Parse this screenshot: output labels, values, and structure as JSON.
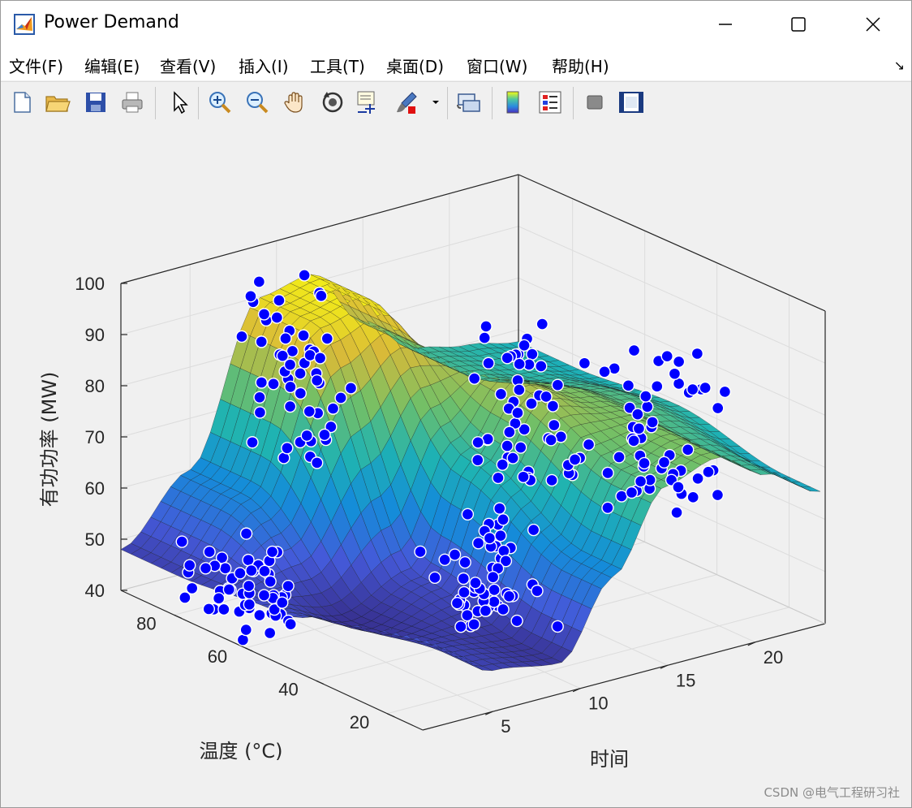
{
  "window": {
    "title": "Power Demand",
    "controls": [
      "minimize",
      "maximize",
      "close"
    ]
  },
  "menu": [
    {
      "label": "文件(F)"
    },
    {
      "label": "编辑(E)"
    },
    {
      "label": "查看(V)"
    },
    {
      "label": "插入(I)"
    },
    {
      "label": "工具(T)"
    },
    {
      "label": "桌面(D)"
    },
    {
      "label": "窗口(W)"
    },
    {
      "label": "帮助(H)"
    }
  ],
  "toolbar": {
    "buttons": [
      {
        "name": "new-figure",
        "icon": "new-file-icon"
      },
      {
        "name": "open-file",
        "icon": "open-folder-icon"
      },
      {
        "name": "save-figure",
        "icon": "save-icon"
      },
      {
        "name": "print-figure",
        "icon": "print-icon"
      },
      {
        "name": "edit-plot",
        "icon": "pointer-icon"
      },
      {
        "name": "zoom-in",
        "icon": "zoom-in-icon"
      },
      {
        "name": "zoom-out",
        "icon": "zoom-out-icon"
      },
      {
        "name": "pan",
        "icon": "hand-icon"
      },
      {
        "name": "rotate-3d",
        "icon": "rotate-icon"
      },
      {
        "name": "data-cursor",
        "icon": "data-cursor-icon"
      },
      {
        "name": "brush",
        "icon": "brush-icon"
      },
      {
        "name": "link-plot",
        "icon": "link-icon"
      },
      {
        "name": "insert-colorbar",
        "icon": "colorbar-icon"
      },
      {
        "name": "insert-legend",
        "icon": "legend-icon"
      },
      {
        "name": "hide-plot-tools",
        "icon": "hide-tools-icon"
      },
      {
        "name": "show-plot-tools",
        "icon": "show-tools-icon"
      }
    ]
  },
  "chart_data": {
    "type": "surface-scatter-3d",
    "title": "",
    "xlabel": "时间",
    "ylabel": "温度 (°C)",
    "zlabel": "有功功率 (MW)",
    "xticks": [
      5,
      10,
      15,
      20
    ],
    "yticks": [
      20,
      40,
      60,
      80
    ],
    "zticks": [
      40,
      50,
      60,
      70,
      80,
      90,
      100
    ],
    "xlim": [
      1,
      24
    ],
    "ylim": [
      10,
      95
    ],
    "zlim": [
      40,
      100
    ],
    "grid": true,
    "surface_colormap": "parula",
    "marker_color": "#0000ff",
    "marker_edge": "#ffffff",
    "surface_samples_time_x": [
      1,
      5,
      9,
      12,
      15,
      18,
      21,
      24
    ],
    "surface_samples": [
      {
        "temperature": 20,
        "power": [
          60,
          48,
          46,
          60,
          75,
          78,
          72,
          66
        ]
      },
      {
        "temperature": 50,
        "power": [
          50,
          45,
          50,
          70,
          82,
          78,
          74,
          70
        ]
      },
      {
        "temperature": 80,
        "power": [
          48,
          60,
          90,
          92,
          80,
          72,
          70,
          68
        ]
      }
    ],
    "scatter_cluster_summary": [
      {
        "time": 3,
        "temperature": 70,
        "power_range": [
          40,
          55
        ]
      },
      {
        "time": 8,
        "temperature": 80,
        "power_range": [
          65,
          100
        ]
      },
      {
        "time": 12,
        "temperature": 45,
        "power_range": [
          40,
          60
        ]
      },
      {
        "time": 16,
        "temperature": 55,
        "power_range": [
          60,
          90
        ]
      },
      {
        "time": 21,
        "temperature": 40,
        "power_range": [
          55,
          85
        ]
      }
    ]
  },
  "watermark": "CSDN @电气工程研习社"
}
